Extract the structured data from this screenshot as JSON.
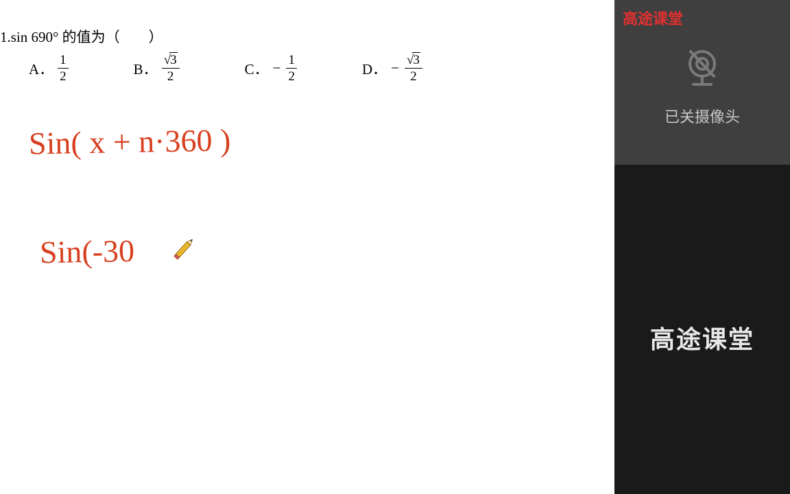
{
  "brand": "高途课堂",
  "camera_status": "已关摄像头",
  "question": {
    "prefix": "1.",
    "expression": "sin 690°",
    "suffix": " 的值为（　　）"
  },
  "options": {
    "A": {
      "label": "A．",
      "num": "1",
      "den": "2",
      "neg": false,
      "sqrt": false
    },
    "B": {
      "label": "B．",
      "num": "3",
      "den": "2",
      "neg": false,
      "sqrt": true
    },
    "C": {
      "label": "C．",
      "num": "1",
      "den": "2",
      "neg": true,
      "sqrt": false
    },
    "D": {
      "label": "D．",
      "num": "3",
      "den": "2",
      "neg": true,
      "sqrt": true
    }
  },
  "handwriting": {
    "line1": "Sin( x + n·360 )",
    "line2": "Sin(-30"
  },
  "colors": {
    "handwriting": "#d84020",
    "brand_red": "#e03030",
    "side_bg": "#1a1a1a",
    "camera_bg": "#3f3f3f"
  }
}
